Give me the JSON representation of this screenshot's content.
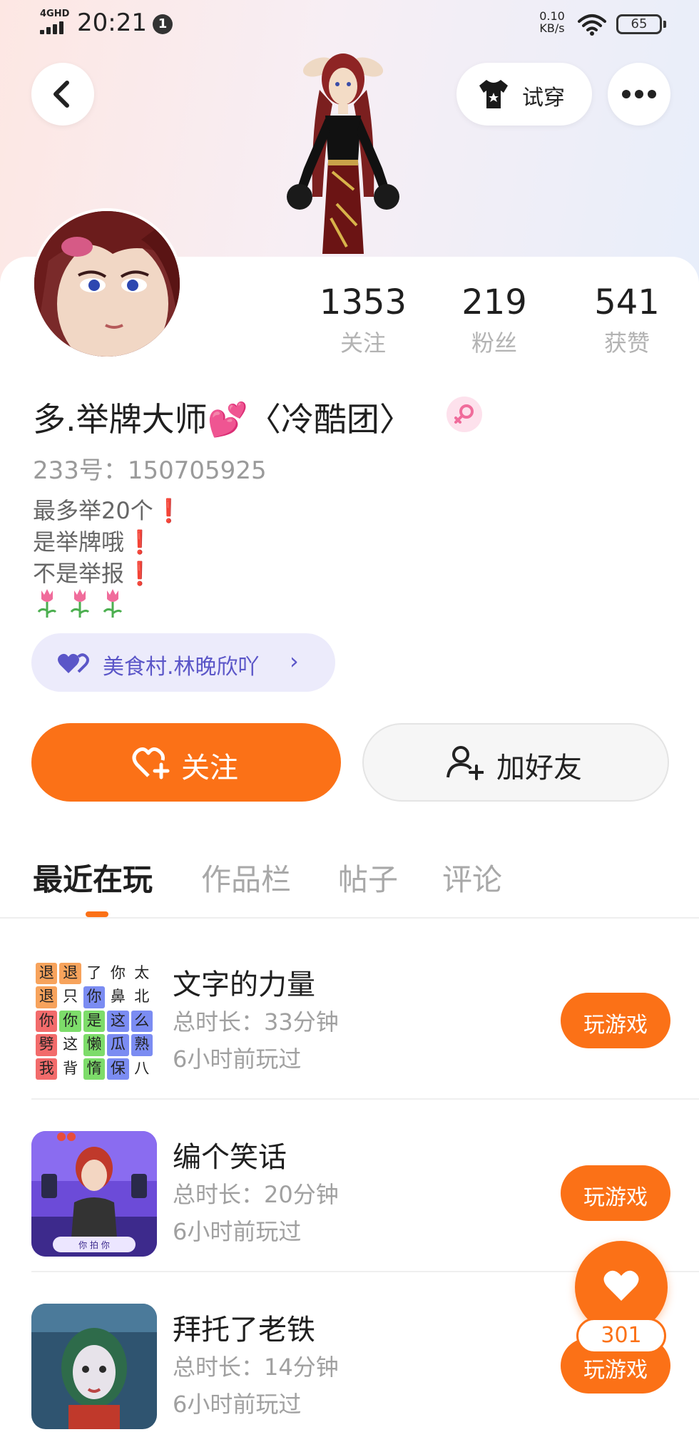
{
  "status_bar": {
    "network": "4GHD",
    "time": "20:21",
    "notification_count": "1",
    "net_speed_value": "0.10",
    "net_speed_unit": "KB/s",
    "battery": "65"
  },
  "header": {
    "tryon_label": "试穿"
  },
  "stats": [
    {
      "value": "1353",
      "label": "关注"
    },
    {
      "value": "219",
      "label": "粉丝"
    },
    {
      "value": "541",
      "label": "获赞"
    }
  ],
  "profile": {
    "nickname": "多.举牌大师💕〈冷酷团〉",
    "uid": "233号：150705925",
    "bio": [
      "最多举20个",
      "是举牌哦",
      "不是举报"
    ],
    "bio_mark": "❗"
  },
  "village": {
    "label": "美食村.林晚欣吖"
  },
  "actions": {
    "follow_label": "关注",
    "add_friend_label": "加好友"
  },
  "tabs": [
    {
      "label": "最近在玩",
      "active": true
    },
    {
      "label": "作品栏",
      "active": false
    },
    {
      "label": "帖子",
      "active": false
    },
    {
      "label": "评论",
      "active": false
    }
  ],
  "word_grid": {
    "cells": [
      "退",
      "退",
      "了",
      "你",
      "太",
      "退",
      "只",
      "你",
      "鼻",
      "北",
      "你",
      "你",
      "是",
      "这",
      "么",
      "劈",
      "这",
      "懒",
      "瓜",
      "熟",
      "我",
      "背",
      "惰",
      "保",
      "八"
    ],
    "colors": [
      "#f7a35c",
      "#f7a35c",
      "",
      "",
      "",
      "#f7a35c",
      "",
      "#7b8cf2",
      "",
      "",
      "#f26b6b",
      "#7ddc6a",
      "#7ddc6a",
      "#7b8cf2",
      "#7b8cf2",
      "#f26b6b",
      "",
      "#7ddc6a",
      "#7b8cf2",
      "#7b8cf2",
      "#f26b6b",
      "",
      "#7ddc6a",
      "#7b8cf2",
      ""
    ]
  },
  "thumb_bottom_text": "你 拍 你",
  "games": [
    {
      "name": "文字的力量",
      "duration": "总时长：33分钟",
      "last_played": "6小时前玩过",
      "button": "玩游戏"
    },
    {
      "name": "编个笑话",
      "duration": "总时长：20分钟",
      "last_played": "6小时前玩过",
      "button": "玩游戏"
    },
    {
      "name": "拜托了老铁",
      "duration": "总时长：14分钟",
      "last_played": "6小时前玩过",
      "button": "玩游戏"
    }
  ],
  "like": {
    "count": "301"
  },
  "colors": {
    "accent": "#fb7117",
    "village_text": "#5b56c8",
    "village_bg": "#ecebfb",
    "gender": "#f06c9b"
  }
}
